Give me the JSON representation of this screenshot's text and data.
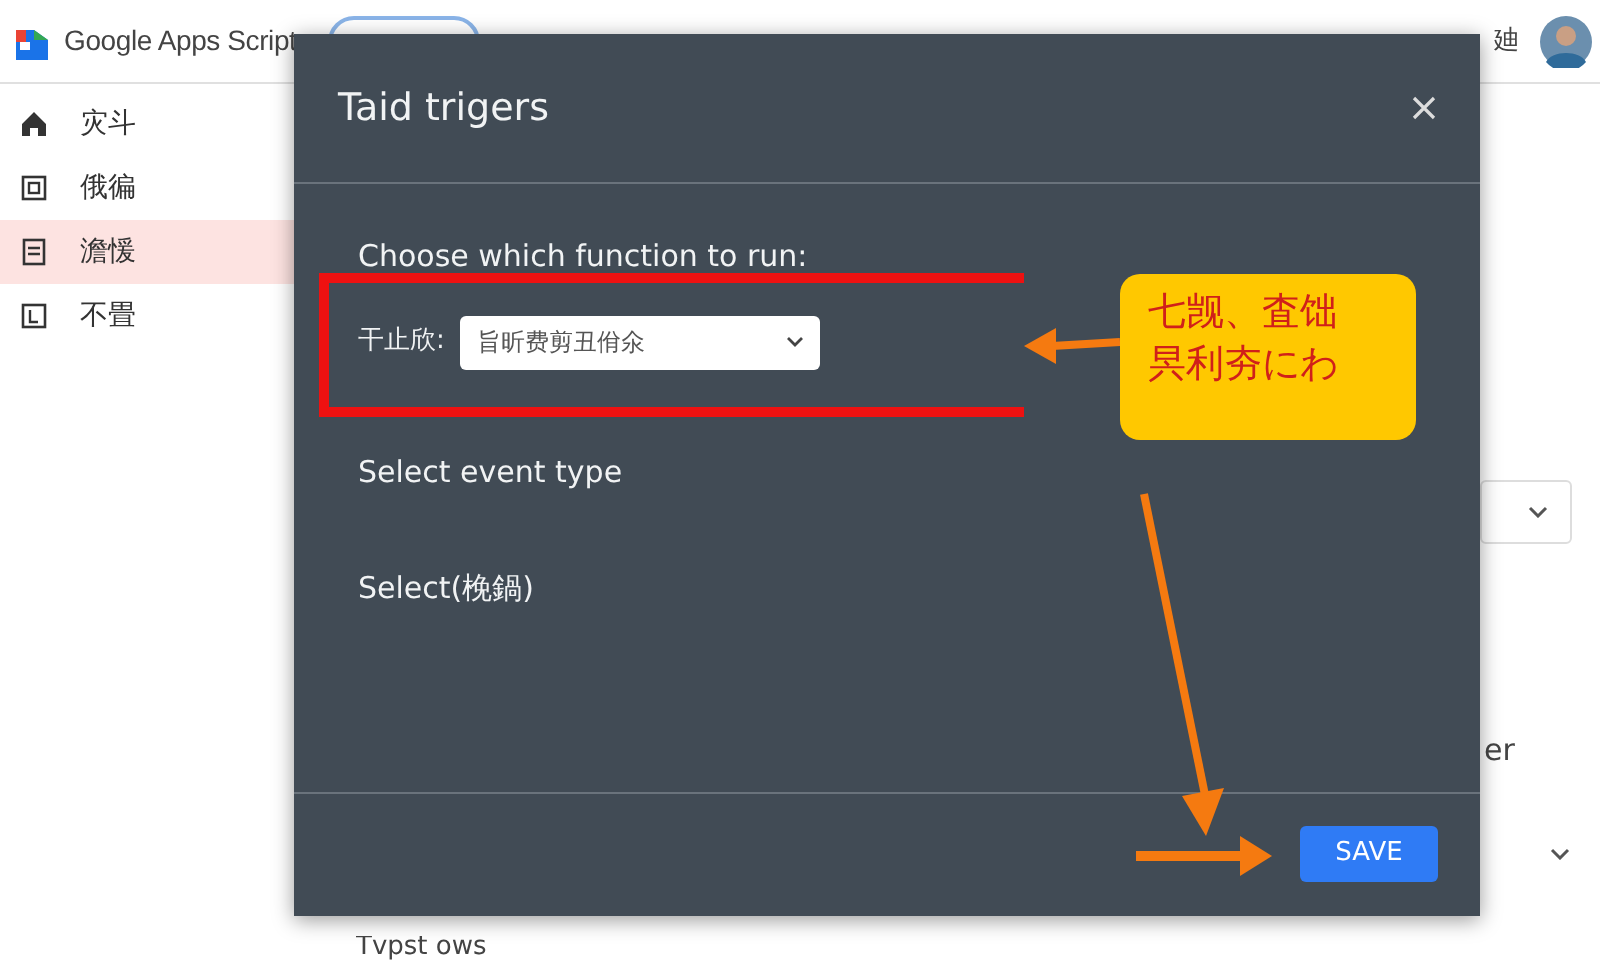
{
  "app": {
    "title": "Google Apps Script",
    "header_text": "廸"
  },
  "sidebar": {
    "items": [
      {
        "label": "灾斗",
        "selected": false
      },
      {
        "label": "俄徧",
        "selected": false
      },
      {
        "label": "澹愋",
        "selected": true
      },
      {
        "label": "不畳",
        "selected": false
      }
    ]
  },
  "background": {
    "trailing_text": "er",
    "row_text": "Tvpst ows"
  },
  "dialog": {
    "title": "Taid trigers",
    "section_label": "Choose which function to run:",
    "field_label": "干止欣:",
    "function_select": {
      "value": "旨昕费剪丑佾氽"
    },
    "event_type_label": "Select event type",
    "select_label": "Select(梚鍋)",
    "save_button": "SAVE"
  },
  "callout": {
    "lines": [
      "七觊、査饳",
      "昗利夯にわ"
    ]
  }
}
